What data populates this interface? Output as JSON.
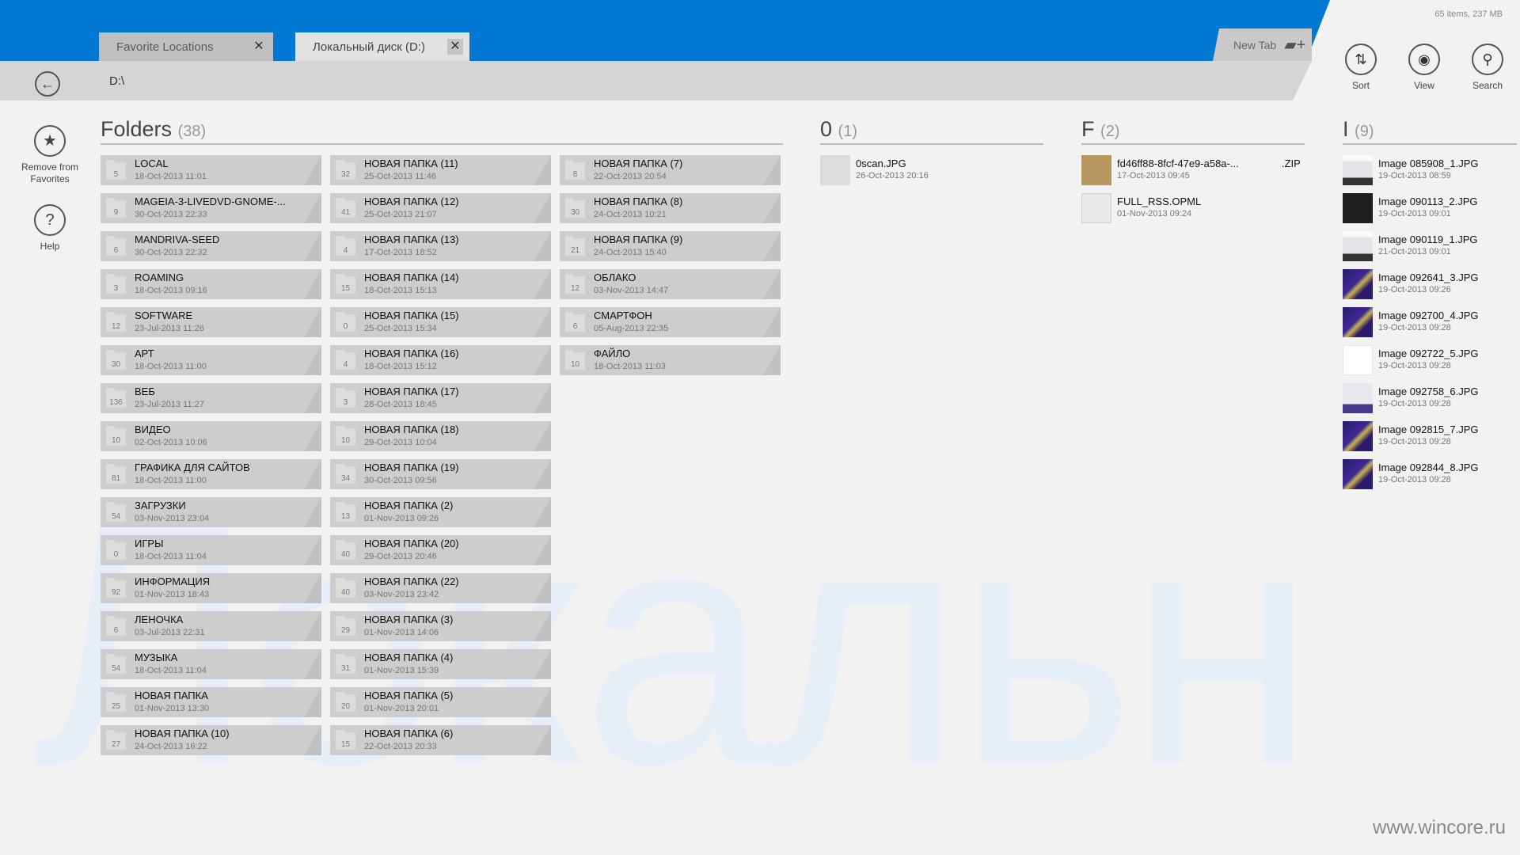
{
  "app": {
    "status": "65 items, 237 MB",
    "tabs": [
      {
        "label": "Favorite Locations",
        "active": false
      },
      {
        "label": "Локальный диск (D:)",
        "active": true
      }
    ],
    "new_tab_label": "New Tab",
    "path": "D:\\",
    "watermark": "Локальн"
  },
  "appbar": {
    "sort_label": "Sort",
    "view_label": "View",
    "search_label": "Search"
  },
  "commands": {
    "remove_favorites_label": "Remove from Favorites",
    "help_label": "Help"
  },
  "sections": {
    "folders": {
      "title": "Folders",
      "count": "(38)"
    },
    "zero": {
      "title": "0",
      "count": "(1)"
    },
    "f": {
      "title": "F",
      "count": "(2)"
    },
    "i": {
      "title": "I",
      "count": "(9)"
    }
  },
  "folders": [
    {
      "name": "LOCAL",
      "date": "18-Oct-2013   11:01",
      "count": "5"
    },
    {
      "name": "MAGEIA-3-LIVEDVD-GNOME-...",
      "date": "30-Oct-2013   22:33",
      "count": "9"
    },
    {
      "name": "MANDRIVA-SEED",
      "date": "30-Oct-2013   22:32",
      "count": "6"
    },
    {
      "name": "ROAMING",
      "date": "18-Oct-2013   09:16",
      "count": "3"
    },
    {
      "name": "SOFTWARE",
      "date": "23-Jul-2013   11:26",
      "count": "12"
    },
    {
      "name": "АРТ",
      "date": "18-Oct-2013   11:00",
      "count": "30"
    },
    {
      "name": "ВЕБ",
      "date": "23-Jul-2013   11:27",
      "count": "136"
    },
    {
      "name": "ВИДЕО",
      "date": "02-Oct-2013   10:06",
      "count": "10"
    },
    {
      "name": "ГРАФИКА ДЛЯ САЙТОВ",
      "date": "18-Oct-2013   11:00",
      "count": "81"
    },
    {
      "name": "ЗАГРУЗКИ",
      "date": "03-Nov-2013   23:04",
      "count": "54"
    },
    {
      "name": "ИГРЫ",
      "date": "18-Oct-2013   11:04",
      "count": "0"
    },
    {
      "name": "ИНФОРМАЦИЯ",
      "date": "01-Nov-2013   18:43",
      "count": "92"
    },
    {
      "name": "ЛЕНОЧКА",
      "date": "03-Jul-2013   22:31",
      "count": "6"
    },
    {
      "name": "МУЗЫКА",
      "date": "18-Oct-2013   11:04",
      "count": "54"
    },
    {
      "name": "НОВАЯ ПАПКА",
      "date": "01-Nov-2013   13:30",
      "count": "25"
    },
    {
      "name": "НОВАЯ ПАПКА (10)",
      "date": "24-Oct-2013   16:22",
      "count": "27"
    },
    {
      "name": "НОВАЯ ПАПКА (11)",
      "date": "25-Oct-2013   11:46",
      "count": "32"
    },
    {
      "name": "НОВАЯ ПАПКА (12)",
      "date": "25-Oct-2013   21:07",
      "count": "41"
    },
    {
      "name": "НОВАЯ ПАПКА (13)",
      "date": "17-Oct-2013   18:52",
      "count": "4"
    },
    {
      "name": "НОВАЯ ПАПКА (14)",
      "date": "18-Oct-2013   15:13",
      "count": "15"
    },
    {
      "name": "НОВАЯ ПАПКА (15)",
      "date": "25-Oct-2013   15:34",
      "count": "0"
    },
    {
      "name": "НОВАЯ ПАПКА (16)",
      "date": "18-Oct-2013   15:12",
      "count": "4"
    },
    {
      "name": "НОВАЯ ПАПКА (17)",
      "date": "28-Oct-2013   18:45",
      "count": "3"
    },
    {
      "name": "НОВАЯ ПАПКА (18)",
      "date": "29-Oct-2013   10:04",
      "count": "10"
    },
    {
      "name": "НОВАЯ ПАПКА (19)",
      "date": "30-Oct-2013   09:56",
      "count": "34"
    },
    {
      "name": "НОВАЯ ПАПКА (2)",
      "date": "01-Nov-2013   09:26",
      "count": "13"
    },
    {
      "name": "НОВАЯ ПАПКА (20)",
      "date": "29-Oct-2013   20:46",
      "count": "40"
    },
    {
      "name": "НОВАЯ ПАПКА (22)",
      "date": "03-Nov-2013   23:42",
      "count": "40"
    },
    {
      "name": "НОВАЯ ПАПКА (3)",
      "date": "01-Nov-2013   14:06",
      "count": "29"
    },
    {
      "name": "НОВАЯ ПАПКА (4)",
      "date": "01-Nov-2013   15:39",
      "count": "31"
    },
    {
      "name": "НОВАЯ ПАПКА (5)",
      "date": "01-Nov-2013   20:01",
      "count": "20"
    },
    {
      "name": "НОВАЯ ПАПКА (6)",
      "date": "22-Oct-2013   20:33",
      "count": "15"
    },
    {
      "name": "НОВАЯ ПАПКА (7)",
      "date": "22-Oct-2013   20:54",
      "count": "8"
    },
    {
      "name": "НОВАЯ ПАПКА (8)",
      "date": "24-Oct-2013   10:21",
      "count": "30"
    },
    {
      "name": "НОВАЯ ПАПКА (9)",
      "date": "24-Oct-2013   15:40",
      "count": "21"
    },
    {
      "name": "ОБЛАКО",
      "date": "03-Nov-2013   14:47",
      "count": "12"
    },
    {
      "name": "СМАРТФОН",
      "date": "05-Aug-2013   22:35",
      "count": "6"
    },
    {
      "name": "ФАЙЛО",
      "date": "18-Oct-2013   11:03",
      "count": "10"
    }
  ],
  "files_zero": [
    {
      "name": "0scan.JPG",
      "date": "26-Oct-2013   20:16"
    }
  ],
  "files_f": [
    {
      "name": "fd46ff88-8fcf-47e9-a58a-...",
      "ext": ".ZIP",
      "date": "17-Oct-2013   09:45"
    },
    {
      "name": "FULL_RSS.OPML",
      "ext": "",
      "date": "01-Nov-2013   09:24"
    }
  ],
  "files_i": [
    {
      "name": "Image 085908_1.JPG",
      "date": "19-Oct-2013   08:59",
      "thumb": "screen"
    },
    {
      "name": "Image 090113_2.JPG",
      "date": "19-Oct-2013   09:01",
      "thumb": "dark"
    },
    {
      "name": "Image 090119_1.JPG",
      "date": "21-Oct-2013   09:01",
      "thumb": "screen"
    },
    {
      "name": "Image 092641_3.JPG",
      "date": "19-Oct-2013   09:26",
      "thumb": "purple"
    },
    {
      "name": "Image 092700_4.JPG",
      "date": "19-Oct-2013   09:28",
      "thumb": "purple"
    },
    {
      "name": "Image 092722_5.JPG",
      "date": "19-Oct-2013   09:28",
      "thumb": "white"
    },
    {
      "name": "Image 092758_6.JPG",
      "date": "19-Oct-2013   09:28",
      "thumb": "screen2"
    },
    {
      "name": "Image 092815_7.JPG",
      "date": "19-Oct-2013   09:28",
      "thumb": "purple"
    },
    {
      "name": "Image 092844_8.JPG",
      "date": "19-Oct-2013   09:28",
      "thumb": "purple"
    }
  ],
  "footer_watermark": "www.wincore.ru",
  "colors": {
    "accent": "#0078d4",
    "tile": "#cdcdcd"
  }
}
